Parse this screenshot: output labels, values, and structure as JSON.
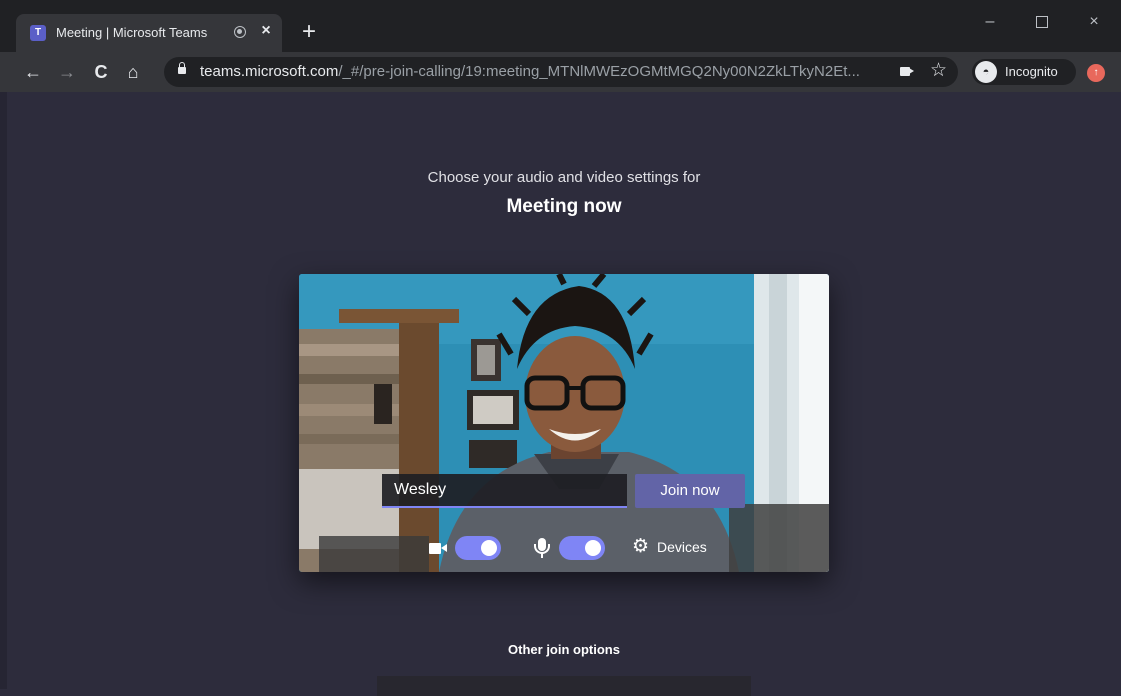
{
  "browser": {
    "tab": {
      "title": "Meeting | Microsoft Teams",
      "favicon": "teams-icon",
      "recording_indicator": "media-recording-icon",
      "close": "×"
    },
    "new_tab": "+",
    "window_controls": {
      "minimize": "–",
      "maximize": "□",
      "close": "×"
    },
    "toolbar": {
      "back": "←",
      "forward": "→",
      "reload": "C",
      "home": "⌂",
      "url_host": "teams.microsoft.com",
      "url_path": "/_#/pre-join-calling/19:meeting_MTNlMWEzOGMtMGQ2Ny00N2ZkLTkyN2Et...",
      "camera_in_use": "camera-icon",
      "bookmark": "☆",
      "profile_label": "Incognito",
      "incognito_icon": "incognito-icon",
      "update_icon": "update-icon"
    }
  },
  "page": {
    "subtitle": "Choose your audio and video settings for",
    "meeting_title": "Meeting now",
    "name_input_value": "Wesley",
    "join_button": "Join now",
    "controls": {
      "video_on": true,
      "mic_on": true,
      "devices_label": "Devices"
    },
    "other_join_options": "Other join options"
  },
  "colors": {
    "page_bg": "#2d2c3c",
    "accent": "#6264a7",
    "toggle_on": "#7f85f5",
    "chrome_dark": "#202124",
    "chrome_toolbar": "#35363a"
  }
}
